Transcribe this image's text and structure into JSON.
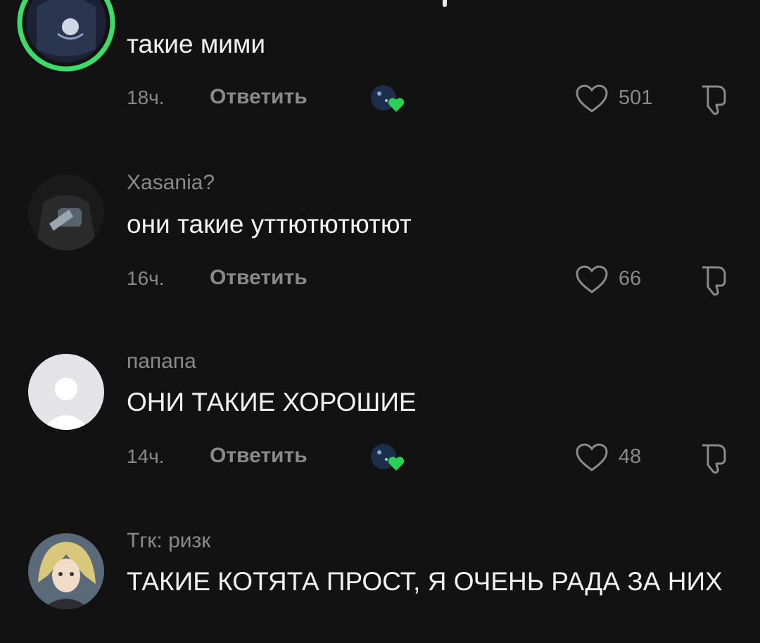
{
  "comments": [
    {
      "username": "",
      "text": "такие мими",
      "time": "18ч.",
      "reply_label": "Ответить",
      "likes": "501",
      "creator_liked": true
    },
    {
      "username": "Xasania?",
      "text": "они такие уттютютютют",
      "time": "16ч.",
      "reply_label": "Ответить",
      "likes": "66",
      "creator_liked": false
    },
    {
      "username": "папапа",
      "text": "ОНИ ТАКИЕ ХОРОШИЕ",
      "time": "14ч.",
      "reply_label": "Ответить",
      "likes": "48",
      "creator_liked": true
    },
    {
      "username": "Тгк: ризк",
      "text": "ТАКИЕ КОТЯТА ПРОСТ, Я ОЧЕНЬ РАДА ЗА НИХ"
    }
  ],
  "colors": {
    "background": "#121212",
    "secondary_text": "#8a8a8a",
    "story_ring": "#3ddc6a",
    "creator_heart": "#2bd155"
  },
  "icons": {
    "like": "heart-outline-icon",
    "dislike": "thumbs-down-icon",
    "creator_liked": "creator-avatar-heart-badge"
  }
}
